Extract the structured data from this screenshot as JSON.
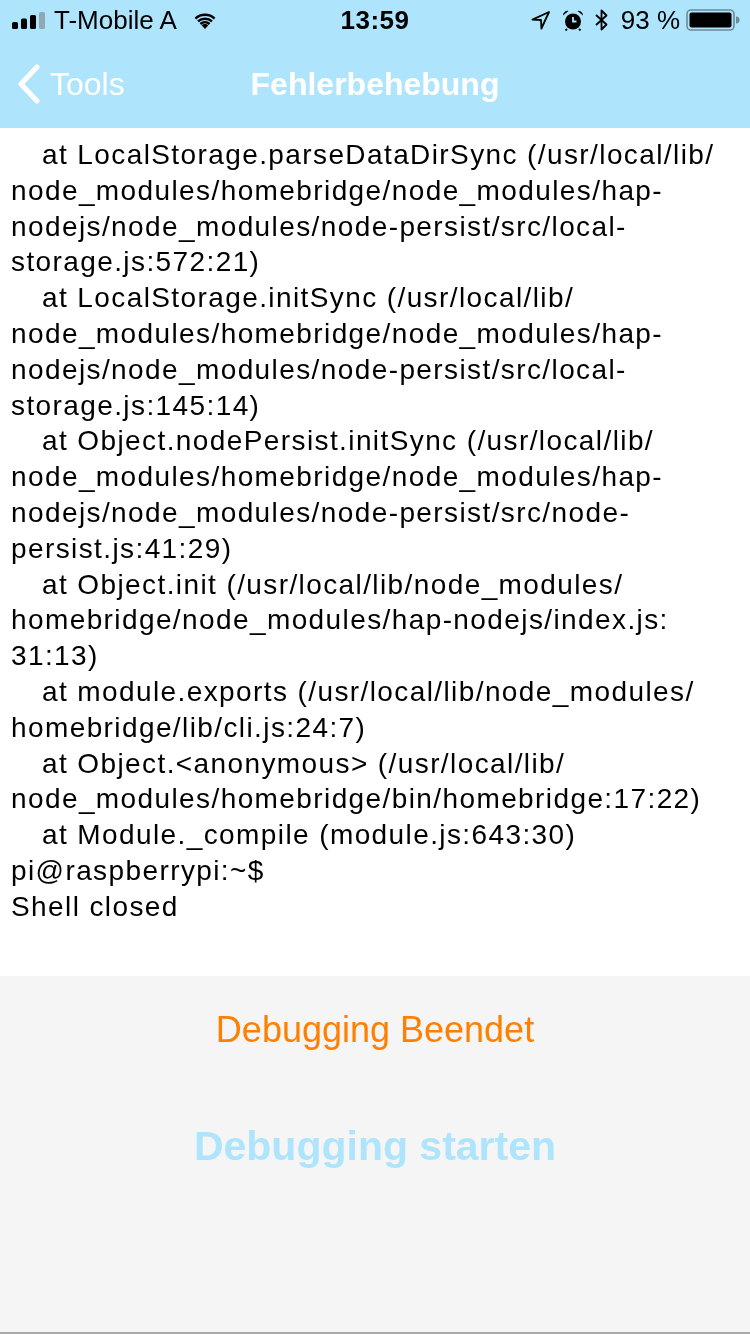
{
  "status_bar": {
    "carrier": "T-Mobile A",
    "time": "13:59",
    "battery": "93 %"
  },
  "nav_bar": {
    "back_label": "Tools",
    "title": "Fehlerbehebung"
  },
  "log": {
    "entries": [
      {
        "kind": "frame",
        "lines": [
          "at LocalStorage.parseDataDirSync (/usr/local/lib/",
          "node_modules/homebridge/node_modules/hap-",
          "nodejs/node_modules/node-persist/src/local-",
          "storage.js:572:21)"
        ]
      },
      {
        "kind": "frame",
        "lines": [
          "at LocalStorage.initSync (/usr/local/lib/",
          "node_modules/homebridge/node_modules/hap-",
          "nodejs/node_modules/node-persist/src/local-",
          "storage.js:145:14)"
        ]
      },
      {
        "kind": "frame",
        "lines": [
          "at Object.nodePersist.initSync (/usr/local/lib/",
          "node_modules/homebridge/node_modules/hap-",
          "nodejs/node_modules/node-persist/src/node-",
          "persist.js:41:29)"
        ]
      },
      {
        "kind": "frame",
        "lines": [
          "at Object.init (/usr/local/lib/node_modules/",
          "homebridge/node_modules/hap-nodejs/index.js:",
          "31:13)"
        ]
      },
      {
        "kind": "frame",
        "lines": [
          "at module.exports (/usr/local/lib/node_modules/",
          "homebridge/lib/cli.js:24:7)"
        ]
      },
      {
        "kind": "frame",
        "lines": [
          "at Object.<anonymous> (/usr/local/lib/",
          "node_modules/homebridge/bin/homebridge:17:22)"
        ]
      },
      {
        "kind": "frame",
        "lines": [
          "at Module._compile (module.js:643:30)"
        ]
      },
      {
        "kind": "output",
        "lines": [
          "pi@raspberrypi:~$"
        ]
      },
      {
        "kind": "output",
        "lines": [
          "Shell closed"
        ]
      }
    ]
  },
  "debug_panel": {
    "status": "Debugging Beendet",
    "start_button": "Debugging starten"
  }
}
